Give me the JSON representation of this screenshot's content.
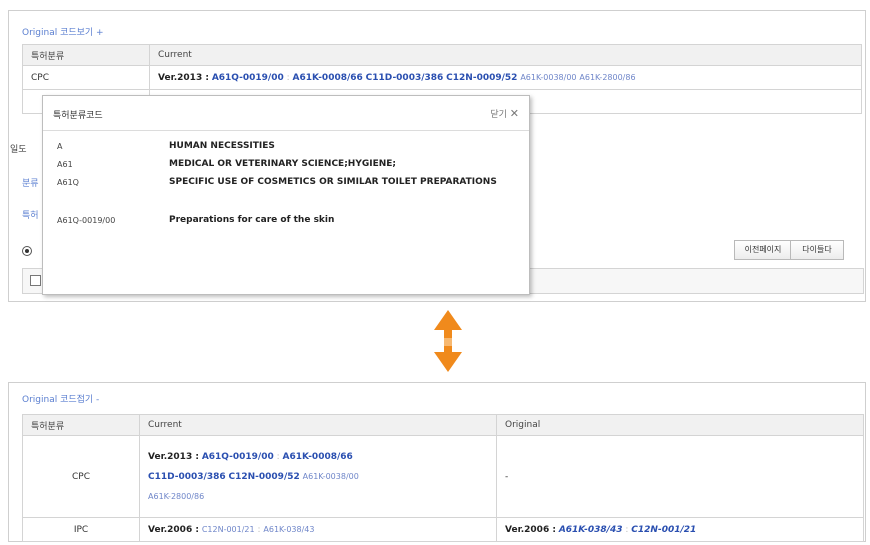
{
  "top": {
    "toggle_label": "Original 코드보기 +",
    "table": {
      "headers": [
        "특허분류",
        "Current"
      ],
      "row": {
        "type": "CPC",
        "version": "Ver.2013 :",
        "codes_bold": [
          "A61Q-0019/00",
          "A61K-0008/66",
          "C11D-0003/386",
          "C12N-0009/52"
        ],
        "codes_plain": [
          "A61K-0038/00",
          "A61K-2800/86"
        ]
      }
    },
    "behind_labels": [
      "일도",
      "분류",
      "특허"
    ],
    "buttons": {
      "prev": "이전페이지",
      "next": "다이들다"
    }
  },
  "popup": {
    "title": "특허분류코드",
    "close": "닫기",
    "close_icon": "close-x-icon",
    "rows": [
      {
        "code": "A",
        "desc": "HUMAN NECESSITIES"
      },
      {
        "code": "A61",
        "desc": "MEDICAL OR VETERINARY SCIENCE;HYGIENE;"
      },
      {
        "code": "A61Q",
        "desc": "SPECIFIC USE OF COSMETICS OR SIMILAR TOILET PREPARATIONS"
      },
      {
        "code": "A61Q-0019/00",
        "desc": "Preparations for care of the skin"
      }
    ]
  },
  "arrow": {
    "icon": "up-down-arrow-icon",
    "color": "#f08a1c"
  },
  "bottom": {
    "toggle_label": "Original 코드접기 -",
    "table": {
      "headers": [
        "특허분류",
        "Current",
        "Original"
      ],
      "cpc": {
        "type": "CPC",
        "version": "Ver.2013 :",
        "line1_codes": [
          "A61Q-0019/00",
          "A61K-0008/66"
        ],
        "line2_codes": [
          "C11D-0003/386",
          "C12N-0009/52"
        ],
        "line2_plain": "A61K-0038/00",
        "line3_plain": "A61K-2800/86",
        "original": "-"
      },
      "ipc": {
        "type": "IPC",
        "version": "Ver.2006 :",
        "current_codes": [
          "C12N-001/21",
          "A61K-038/43"
        ],
        "orig_version": "Ver.2006 :",
        "original_codes": [
          "A61K-038/43",
          "C12N-001/21"
        ]
      }
    }
  }
}
